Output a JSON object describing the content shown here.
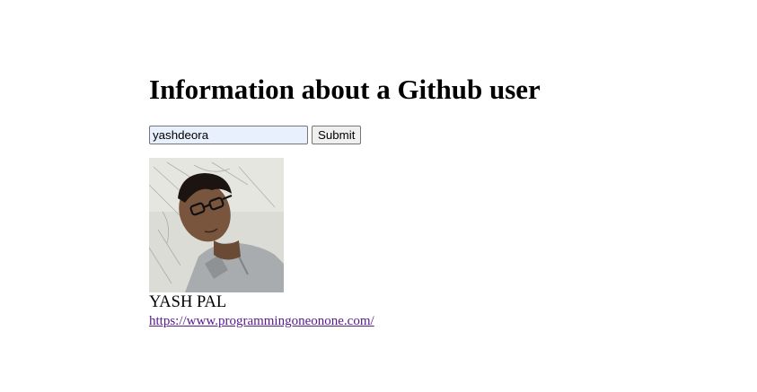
{
  "page": {
    "title": "Information about a Github user"
  },
  "search": {
    "value": "yashdeora",
    "submit_label": "Submit"
  },
  "user": {
    "name": "YASH PAL",
    "blog_url": "https://www.programmingoneonone.com/"
  },
  "colors": {
    "link_visited": "#551a8b",
    "input_autofill_bg": "#e8f0fe",
    "button_bg": "#efefef"
  },
  "icons": {
    "avatar": "user-avatar-photo"
  }
}
